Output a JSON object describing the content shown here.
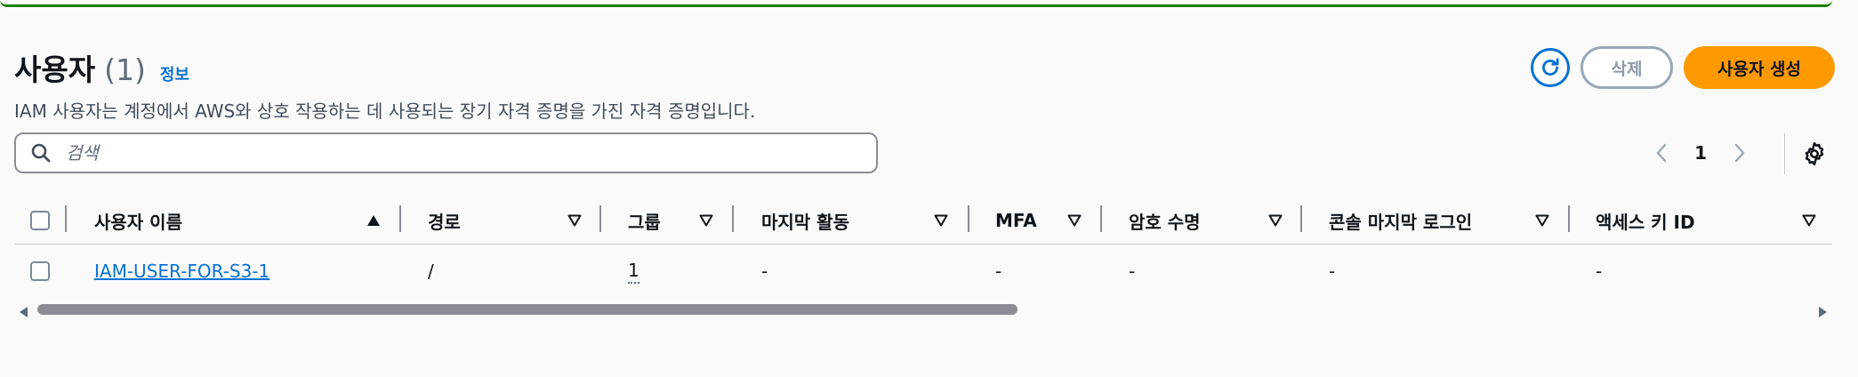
{
  "header": {
    "title": "사용자",
    "count": "(1)",
    "info_link": "정보",
    "description": "IAM 사용자는 계정에서 AWS와 상호 작용하는 데 사용되는 장기 자격 증명을 가진 자격 증명입니다."
  },
  "actions": {
    "refresh_icon": "refresh-icon",
    "delete_label": "삭제",
    "create_label": "사용자 생성"
  },
  "search": {
    "placeholder": "검색",
    "value": ""
  },
  "pagination": {
    "current_page": "1"
  },
  "table": {
    "columns": [
      {
        "label": "사용자 이름",
        "sort": "ascending"
      },
      {
        "label": "경로",
        "sort": "none"
      },
      {
        "label": "그룹",
        "sort": "none"
      },
      {
        "label": "마지막 활동",
        "sort": "none"
      },
      {
        "label": "MFA",
        "sort": "none"
      },
      {
        "label": "암호 수명",
        "sort": "none"
      },
      {
        "label": "콘솔 마지막 로그인",
        "sort": "none"
      },
      {
        "label": "액세스 키 ID",
        "sort": "none"
      }
    ],
    "rows": [
      {
        "user_name": "IAM-USER-FOR-S3-1",
        "path": "/",
        "groups": "1",
        "last_activity": "-",
        "mfa": "-",
        "password_age": "-",
        "console_last_login": "-",
        "access_key_id": "-"
      }
    ]
  },
  "colors": {
    "accent": "#0972d3",
    "primary_button": "#ff9900",
    "success_banner": "#1d8102"
  }
}
